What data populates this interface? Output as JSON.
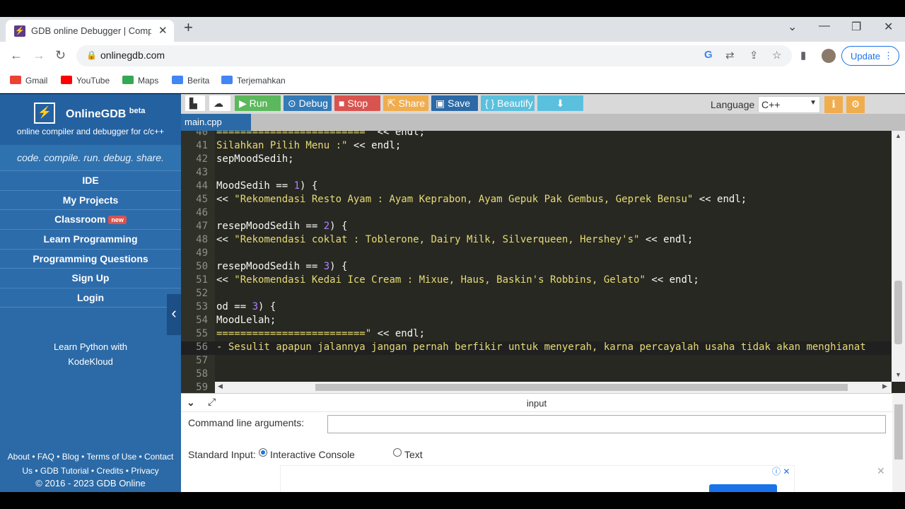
{
  "browser": {
    "tab_title": "GDB online Debugger | Compiler",
    "tab_close": "✕",
    "new_tab": "+",
    "url": "onlinegdb.com",
    "update_label": "Update",
    "window_controls": [
      "⌄",
      "—",
      "❐",
      "✕"
    ]
  },
  "bookmarks": [
    {
      "label": "Gmail",
      "color": "#ea4335"
    },
    {
      "label": "YouTube",
      "color": "#ff0000"
    },
    {
      "label": "Maps",
      "color": "#34a853"
    },
    {
      "label": "Berita",
      "color": "#4285f4"
    },
    {
      "label": "Terjemahkan",
      "color": "#4285f4"
    }
  ],
  "sidebar": {
    "brand_name": "OnlineGDB",
    "brand_beta": "beta",
    "brand_sub": "online compiler and debugger for c/c++",
    "tagline": "code. compile. run. debug. share.",
    "items": [
      {
        "label": "IDE"
      },
      {
        "label": "My Projects"
      },
      {
        "label": "Classroom",
        "badge": "new"
      },
      {
        "label": "Learn Programming"
      },
      {
        "label": "Programming Questions"
      },
      {
        "label": "Sign Up"
      },
      {
        "label": "Login"
      }
    ],
    "ad_line1": "Learn Python with",
    "ad_line2": "KodeKloud",
    "footer_line1": "About • FAQ • Blog • Terms of Use • Contact",
    "footer_line2": "Us • GDB Tutorial • Credits • Privacy",
    "copyright": "© 2016 - 2023 GDB Online"
  },
  "toolbar": {
    "run": "Run",
    "debug": "Debug",
    "stop": "Stop",
    "share": "Share",
    "save": "Save",
    "beautify": "{ } Beautify",
    "language_label": "Language",
    "language_value": "C++"
  },
  "colors": {
    "run": "#5cb85c",
    "debug": "#337ab7",
    "stop": "#d9534f",
    "share": "#f0ad4e",
    "save": "#2b6aa6",
    "beautify": "#5bc0de",
    "download": "#5bc0de"
  },
  "file_tab": "main.cpp",
  "editor": {
    "lines": [
      {
        "n": "40",
        "pre": "",
        "str": "=========================\"",
        "post": " << endl;"
      },
      {
        "n": "41",
        "pre": "",
        "str": "Silahkan Pilih Menu :\"",
        "post": " << endl;"
      },
      {
        "n": "42",
        "pre": "sepMoodSedih;",
        "str": "",
        "post": ""
      },
      {
        "n": "43",
        "pre": "",
        "str": "",
        "post": ""
      },
      {
        "n": "44",
        "pre": "MoodSedih == ",
        "num": "1",
        "post2": ") {"
      },
      {
        "n": "45",
        "pre": "<< ",
        "str": "\"Rekomendasi Resto Ayam : Ayam Keprabon, Ayam Gepuk Pak Gembus, Geprek Bensu\"",
        "post": " << endl;"
      },
      {
        "n": "46",
        "pre": "",
        "str": "",
        "post": ""
      },
      {
        "n": "47",
        "pre": "resepMoodSedih == ",
        "num": "2",
        "post2": ") {"
      },
      {
        "n": "48",
        "pre": "<< ",
        "str": "\"Rekomendasi coklat : Toblerone, Dairy Milk, Silverqueen, Hershey's\"",
        "post": " << endl;"
      },
      {
        "n": "49",
        "pre": "",
        "str": "",
        "post": ""
      },
      {
        "n": "50",
        "pre": "resepMoodSedih == ",
        "num": "3",
        "post2": ") {"
      },
      {
        "n": "51",
        "pre": "<< ",
        "str": "\"Rekomendasi Kedai Ice Cream : Mixue, Haus, Baskin's Robbins, Gelato\"",
        "post": " << endl;"
      },
      {
        "n": "52",
        "pre": "",
        "str": "",
        "post": ""
      },
      {
        "n": "53",
        "pre": "od == ",
        "num": "3",
        "post2": ") {"
      },
      {
        "n": "54",
        "pre": "MoodLelah;",
        "str": "",
        "post": ""
      },
      {
        "n": "55",
        "pre": "",
        "str": "=========================\"",
        "post": " << endl;"
      },
      {
        "n": "56",
        "pre": "",
        "str": "- Sesulit apapun jalannya jangan pernah berfikir untuk menyerah, karna percayalah usaha tidak akan menghianat",
        "post": ""
      },
      {
        "n": "57",
        "pre": "",
        "str": "",
        "post": ""
      },
      {
        "n": "58",
        "pre": "",
        "str": "",
        "post": ""
      },
      {
        "n": "59",
        "pre": "",
        "str": "",
        "post": ""
      }
    ]
  },
  "input_panel": {
    "title": "input",
    "cla_label": "Command line arguments:",
    "stdin_label": "Standard Input:",
    "option_console": "Interactive Console",
    "option_text": "Text"
  }
}
